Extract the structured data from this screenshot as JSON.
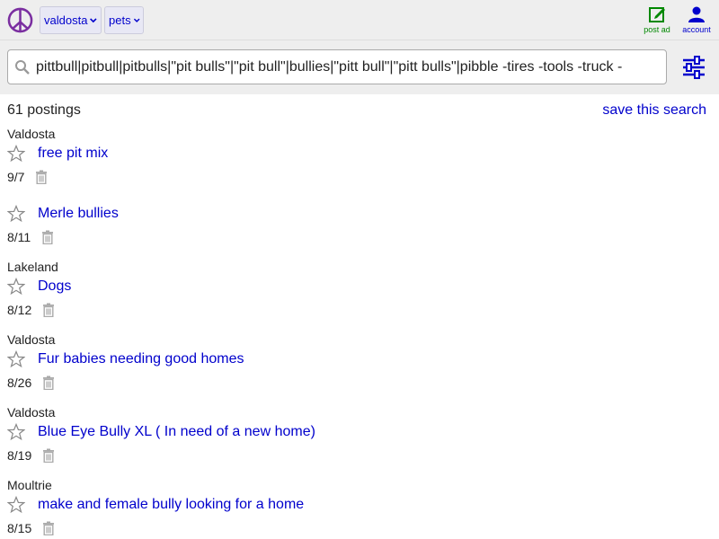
{
  "header": {
    "logo_icon": "peace-sign-icon",
    "city": "valdosta",
    "category": "pets",
    "post_ad_label": "post ad",
    "account_label": "account",
    "post_ad_color": "#008800",
    "link_color": "#0000cc"
  },
  "search": {
    "query": "pittbull|pitbull|pitbulls|\"pit bulls\"|\"pit bull\"|bullies|\"pitt bull\"|\"pitt bulls\"|pibble -tires -tools -truck -"
  },
  "results": {
    "count_text": "61 postings",
    "save_label": "save this search"
  },
  "postings": [
    {
      "location": "Valdosta",
      "title": "free pit mix",
      "date": "9/7"
    },
    {
      "location": "",
      "title": "Merle bullies",
      "date": "8/11"
    },
    {
      "location": "Lakeland",
      "title": "Dogs",
      "date": "8/12"
    },
    {
      "location": "Valdosta",
      "title": "Fur babies needing good homes",
      "date": "8/26"
    },
    {
      "location": "Valdosta",
      "title": "Blue Eye Bully XL ( In need of a new home)",
      "date": "8/19"
    },
    {
      "location": "Moultrie",
      "title": "make and female bully looking for a home",
      "date": "8/15"
    }
  ]
}
